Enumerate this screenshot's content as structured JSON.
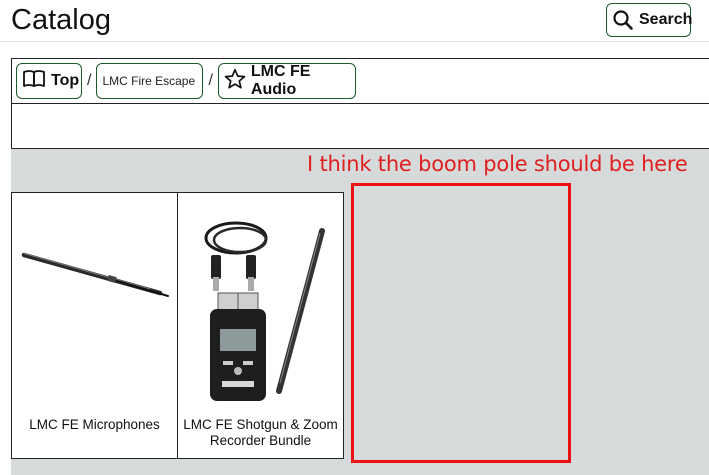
{
  "header": {
    "title": "Catalog",
    "search_label": "Search"
  },
  "breadcrumb": {
    "items": [
      {
        "label": "Top",
        "icon": "book-icon"
      },
      {
        "label": "LMC Fire Escape"
      },
      {
        "label": "LMC FE Audio",
        "icon": "star-icon"
      }
    ],
    "separator": "/"
  },
  "products": [
    {
      "label": "LMC FE Microphones",
      "image": "shotgun-microphone"
    },
    {
      "label": "LMC FE Shotgun & Zoom Recorder Bundle",
      "image": "xlr-cable-zoom-recorder-shotgun-mic"
    }
  ],
  "annotation": {
    "text": "I think the boom pole should be here",
    "color": "#e02020"
  },
  "colors": {
    "button_border": "#1f5a2a",
    "catalog_background": "#d6dada",
    "annotation": "#ee1111"
  }
}
